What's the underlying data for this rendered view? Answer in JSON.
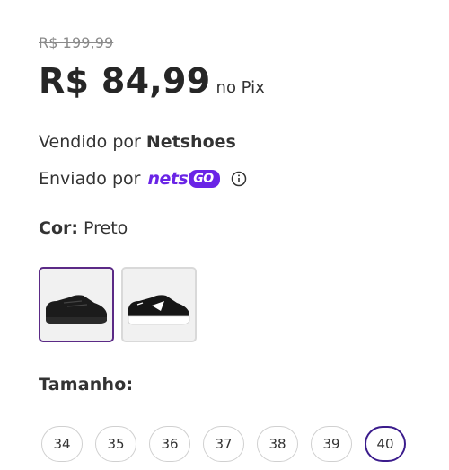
{
  "pricing": {
    "old_price": "R$ 199,99",
    "price": "R$ 84,99",
    "price_suffix": "no Pix"
  },
  "seller": {
    "sold_prefix": "Vendido por",
    "sold_name": "Netshoes",
    "shipped_prefix": "Enviado por",
    "shipped_brand_a": "nets",
    "shipped_brand_b": "GO"
  },
  "color": {
    "label": "Cor:",
    "value": "Preto",
    "swatches": [
      {
        "name": "Preto",
        "selected": true
      },
      {
        "name": "Preto e Branco",
        "selected": false
      }
    ]
  },
  "size": {
    "label": "Tamanho:",
    "options": [
      "34",
      "35",
      "36",
      "37",
      "38",
      "39",
      "40"
    ],
    "selected": "40"
  },
  "colors": {
    "accent": "#6a24e6",
    "selected_border": "#3b1c8c",
    "text": "#333333",
    "muted": "#8a8a8a"
  },
  "icons": {
    "info": "info-icon"
  }
}
